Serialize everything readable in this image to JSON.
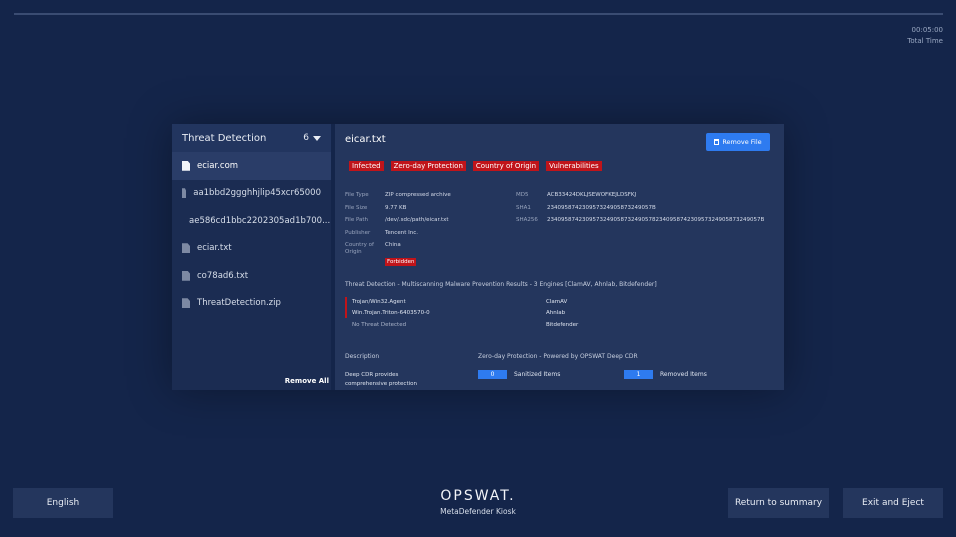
{
  "timer": {
    "value": "00:05:00",
    "label": "Total Time"
  },
  "file_list": {
    "title": "Threat Detection",
    "count": "6",
    "items": [
      {
        "name": "eciar.com",
        "active": true
      },
      {
        "name": "aa1bbd2ggghhjlip45xcr65000",
        "active": false
      },
      {
        "name": "ae586cd1bbc2202305ad1b700...",
        "active": false
      },
      {
        "name": "eciar.txt",
        "active": false
      },
      {
        "name": "co78ad6.txt",
        "active": false
      },
      {
        "name": "ThreatDetection.zip",
        "active": false
      }
    ],
    "remove_all": "Remove All"
  },
  "details": {
    "filename": "eicar.txt",
    "remove_file": "Remove File",
    "tags": [
      "Infected",
      "Zero-day Protection",
      "Country of Origin",
      "Vulnerabilities"
    ],
    "meta_left": [
      {
        "k": "File Type",
        "v": "ZIP compressed archive"
      },
      {
        "k": "File Size",
        "v": "9.77 KB"
      },
      {
        "k": "File Path",
        "v": "/dev/.sdc/path/eicar.txt"
      },
      {
        "k": "Publisher",
        "v": "Tencent Inc."
      }
    ],
    "country": {
      "k": "Country of Origin",
      "v": "China",
      "badge": "Forbidden"
    },
    "meta_right": [
      {
        "k": "MD5",
        "v": "ACB33424DKLJSEWOFKEJLDSFKJ"
      },
      {
        "k": "SHA1",
        "v": "234095874230957324905873249057B"
      },
      {
        "k": "SHA256",
        "v": "2340958742309573249058732490578234095874230957324905873249057B"
      }
    ],
    "threat_title": "Threat Detection - Multiscanning Malware Prevention Results - 3 Engines [ClamAV, Ahnlab, Bitdefender]",
    "engines": [
      {
        "threat": "Trojan/Win32.Agent",
        "engine": "ClamAV"
      },
      {
        "threat": "Win.Trojan.Triton-6403570-0",
        "engine": "Ahnlab"
      },
      {
        "threat": "No Threat Detected",
        "engine": "Bitdefender"
      }
    ],
    "description_label": "Description",
    "description_text": "Deep CDR provides comprehensive protection",
    "cdr_label": "Zero-day Protection - Powered by OPSWAT Deep CDR",
    "sanitized": {
      "value": "0",
      "label": "Sanitized Items"
    },
    "removed": {
      "value": "1",
      "label": "Removed Items"
    }
  },
  "footer": {
    "language": "English",
    "logo": "OPSWAT.",
    "product": "MetaDefender Kiosk",
    "return": "Return to summary",
    "exit": "Exit and Eject"
  },
  "colors": {
    "background": "#14254a",
    "accent": "#2e7bf0",
    "danger": "#c0141a"
  }
}
